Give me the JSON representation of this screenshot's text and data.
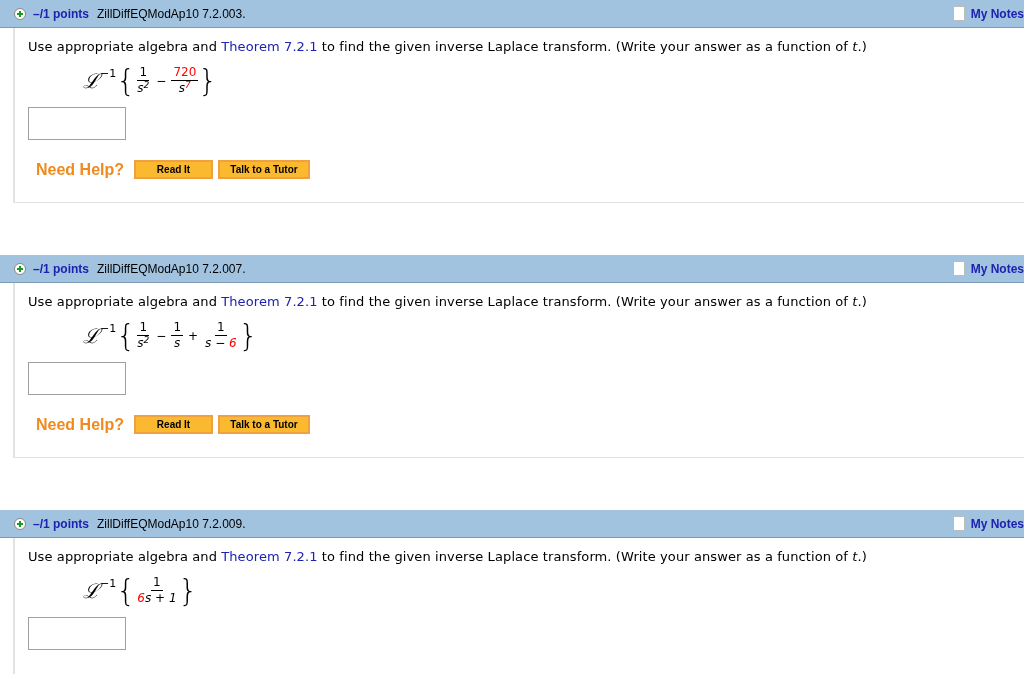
{
  "problems": [
    {
      "points": "–/1 points",
      "code": "ZillDiffEQModAp10 7.2.003.",
      "notes": "My Notes",
      "prompt_before": "Use appropriate algebra and",
      "link": "Theorem 7.2.1",
      "prompt_after": "to find the given inverse Laplace transform. (Write your answer as a function of *t*.)",
      "operator": "ℒ",
      "power": "−1",
      "open": "{",
      "close": "}",
      "terms": [
        {
          "num": [
            {
              "text": "1",
              "red": false
            }
          ],
          "den": [
            {
              "text": "s",
              "red": false
            },
            {
              "text": "$^{2}$",
              "red": false
            }
          ]
        },
        {
          "sign": "−",
          "num": [
            {
              "text": "720",
              "red": true
            }
          ],
          "den": [
            {
              "text": "s",
              "red": false
            },
            {
              "text": "$^{7}$",
              "red": true
            }
          ]
        }
      ],
      "help": {
        "label": "Need Help?",
        "buttons": [
          "Read It",
          "Talk to a Tutor"
        ]
      }
    },
    {
      "points": "–/1 points",
      "code": "ZillDiffEQModAp10 7.2.007.",
      "notes": "My Notes",
      "prompt_before": "Use appropriate algebra and",
      "link": "Theorem 7.2.1",
      "prompt_after": "to find the given inverse Laplace transform. (Write your answer as a function of *t*.)",
      "operator": "ℒ",
      "power": "−1",
      "open": "{",
      "close": "}",
      "terms": [
        {
          "num": [
            {
              "text": "1",
              "red": false
            }
          ],
          "den": [
            {
              "text": "s",
              "red": false
            },
            {
              "text": "$^{2}$",
              "red": false
            }
          ]
        },
        {
          "sign": "−",
          "num": [
            {
              "text": "1",
              "red": false
            }
          ],
          "den": [
            {
              "text": "s",
              "red": false
            }
          ]
        },
        {
          "sign": "+",
          "num": [
            {
              "text": "1",
              "red": false
            }
          ],
          "den": [
            {
              "text": "s − ",
              "red": false
            },
            {
              "text": "6",
              "red": true
            }
          ]
        }
      ],
      "help": {
        "label": "Need Help?",
        "buttons": [
          "Read It",
          "Talk to a Tutor"
        ]
      }
    },
    {
      "points": "–/1 points",
      "code": "ZillDiffEQModAp10 7.2.009.",
      "notes": "My Notes",
      "prompt_before": "Use appropriate algebra and",
      "link": "Theorem 7.2.1",
      "prompt_after": "to find the given inverse Laplace transform. (Write your answer as a function of *t*.)",
      "operator": "ℒ",
      "power": "−1",
      "open": "{",
      "close": "}",
      "terms": [
        {
          "num": [
            {
              "text": "1",
              "red": false
            }
          ],
          "den": [
            {
              "text": "6",
              "red": true
            },
            {
              "text": "s + 1",
              "red": false
            }
          ]
        }
      ]
    }
  ]
}
